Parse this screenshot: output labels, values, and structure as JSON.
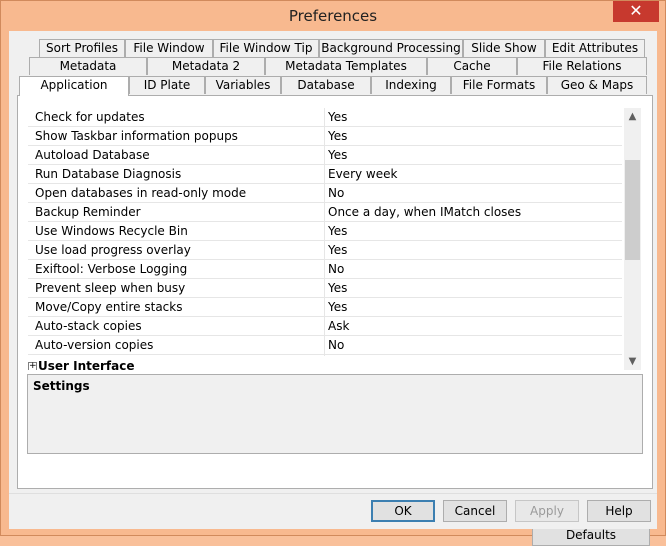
{
  "window": {
    "title": "Preferences",
    "close_glyph": "✕"
  },
  "tabs": {
    "row1": [
      "Sort Profiles",
      "File Window",
      "File Window Tip",
      "Background Processing",
      "Slide Show",
      "Edit Attributes"
    ],
    "row2": [
      "Metadata",
      "Metadata 2",
      "Metadata Templates",
      "Cache",
      "File Relations"
    ],
    "row3": [
      "Application",
      "ID Plate",
      "Variables",
      "Database",
      "Indexing",
      "File Formats",
      "Geo & Maps"
    ],
    "active": "Application"
  },
  "settings": [
    {
      "name": "Check for updates",
      "value": "Yes"
    },
    {
      "name": "Show Taskbar information popups",
      "value": "Yes"
    },
    {
      "name": "Autoload Database",
      "value": "Yes"
    },
    {
      "name": "Run Database Diagnosis",
      "value": "Every week"
    },
    {
      "name": "Open databases in read-only mode",
      "value": "No"
    },
    {
      "name": "Backup Reminder",
      "value": "Once a day, when IMatch closes"
    },
    {
      "name": "Use Windows Recycle Bin",
      "value": "Yes"
    },
    {
      "name": "Use load progress overlay",
      "value": "Yes"
    },
    {
      "name": "Exiftool: Verbose Logging",
      "value": "No"
    },
    {
      "name": "Prevent sleep when busy",
      "value": "Yes"
    },
    {
      "name": "Move/Copy entire stacks",
      "value": "Yes"
    },
    {
      "name": "Auto-stack copies",
      "value": "Ask"
    },
    {
      "name": "Auto-version copies",
      "value": "No"
    }
  ],
  "group": {
    "label": "User Interface",
    "expander_glyph": "+"
  },
  "scrollbar": {
    "up_glyph": "▲",
    "down_glyph": "▼"
  },
  "settings_panel": {
    "label": "Settings"
  },
  "buttons": {
    "defaults": "Defaults",
    "ok": "OK",
    "cancel": "Cancel",
    "apply": "Apply",
    "help": "Help"
  },
  "colors": {
    "titlebar": "#f8b98f",
    "close_button": "#c7392e",
    "default_button_border": "#3c7fb1"
  }
}
